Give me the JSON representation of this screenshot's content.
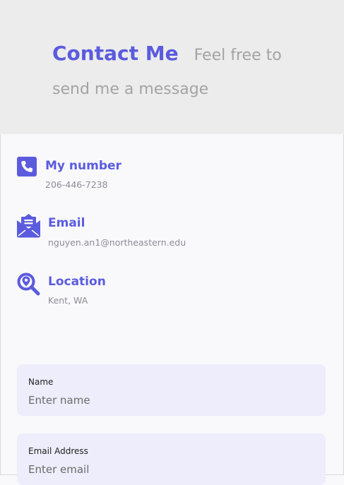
{
  "header": {
    "title": "Contact Me",
    "subtitle": "Feel free to send me a message"
  },
  "contact_info": [
    {
      "icon": "phone-icon",
      "label": "My number",
      "value": "206-446-7238"
    },
    {
      "icon": "mail-icon",
      "label": "Email",
      "value": "nguyen.an1@northeastern.edu"
    },
    {
      "icon": "location-search-icon",
      "label": "Location",
      "value": "Kent, WA"
    }
  ],
  "form": {
    "fields": [
      {
        "label": "Name",
        "placeholder": "Enter name"
      },
      {
        "label": "Email Address",
        "placeholder": "Enter email"
      }
    ]
  },
  "colors": {
    "accent": "#5b5bde",
    "header_bg": "#ececec",
    "page_bg": "#f9f9fc",
    "field_bg": "#ededfb",
    "muted_text": "#8c8c96"
  }
}
